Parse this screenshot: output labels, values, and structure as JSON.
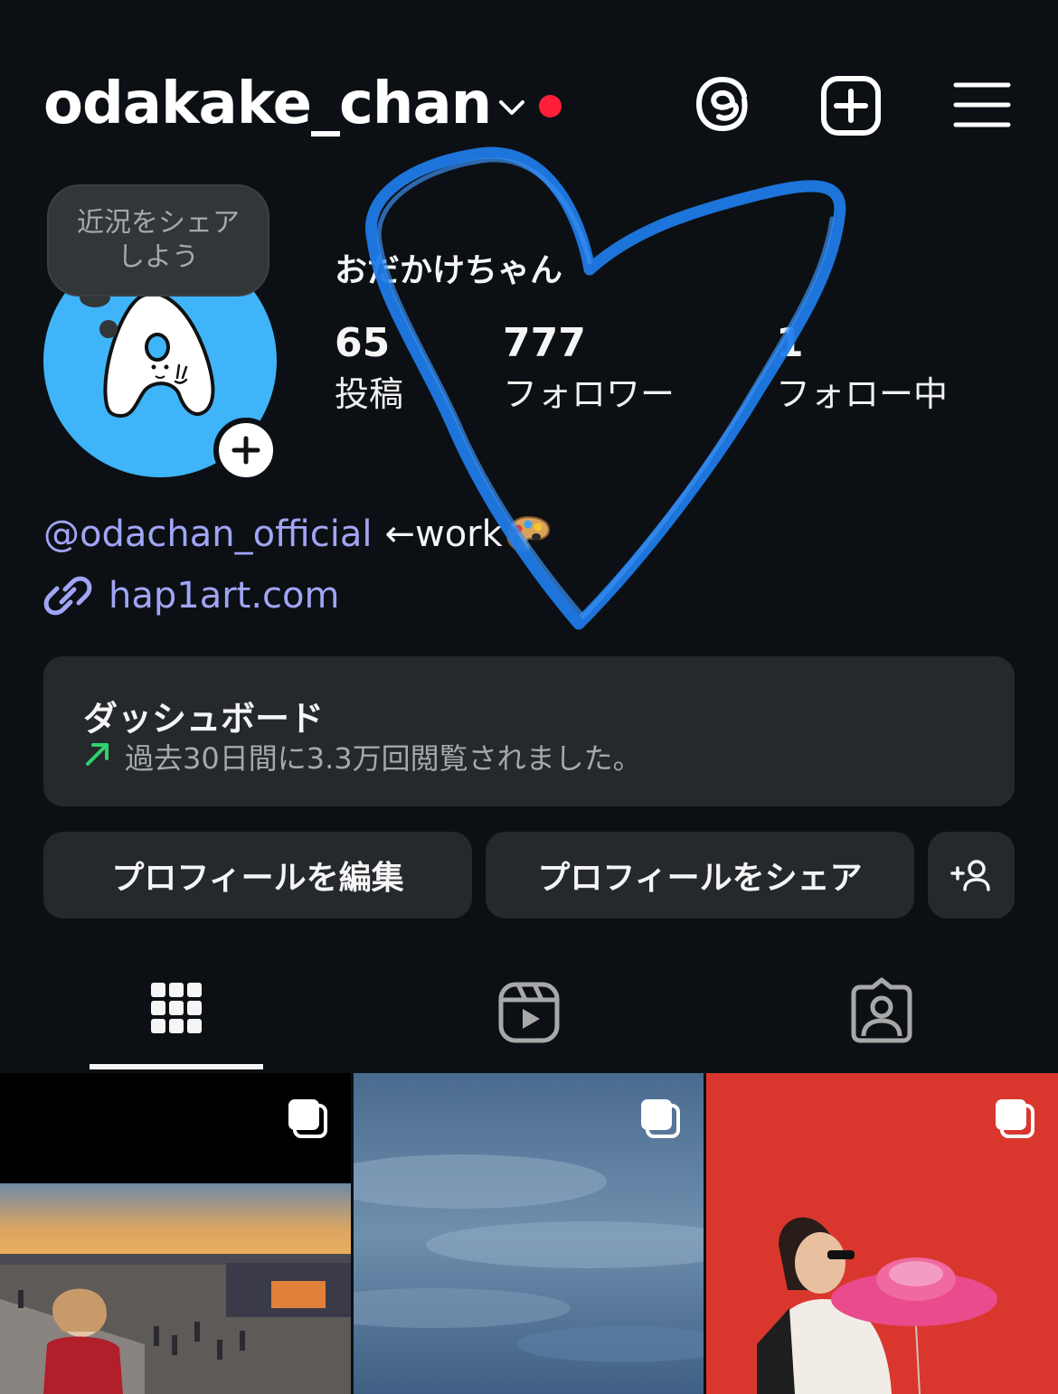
{
  "header": {
    "username": "odakake_chan",
    "icons": [
      "chevron-down-icon",
      "threads-icon",
      "create-icon",
      "menu-icon"
    ],
    "notification_color": "#ff1f3b"
  },
  "profile": {
    "note": {
      "line1": "近況をシェア",
      "line2": "しよう"
    },
    "display_name": "おだかけちゃん",
    "avatar_color": "#3fb4f8",
    "stats": [
      {
        "value": "65",
        "label": "投稿"
      },
      {
        "value": "777",
        "label": "フォロワー"
      },
      {
        "value": "1",
        "label": "フォロー中"
      }
    ],
    "bio": {
      "mention": "@odachan_official",
      "text": "←work"
    },
    "link": "hap1art.com"
  },
  "dashboard": {
    "title": "ダッシュボード",
    "subtitle": "過去30日間に3.3万回閲覧されました。"
  },
  "buttons": {
    "edit": "プロフィールを編集",
    "share": "プロフィールをシェア"
  },
  "tabs": [
    "grid-icon",
    "reels-icon",
    "tagged-icon"
  ],
  "colors": {
    "background": "#0c1014",
    "link": "#a0a5f5",
    "surface": "#25292e",
    "accent_heart": "#1f7ae6"
  }
}
